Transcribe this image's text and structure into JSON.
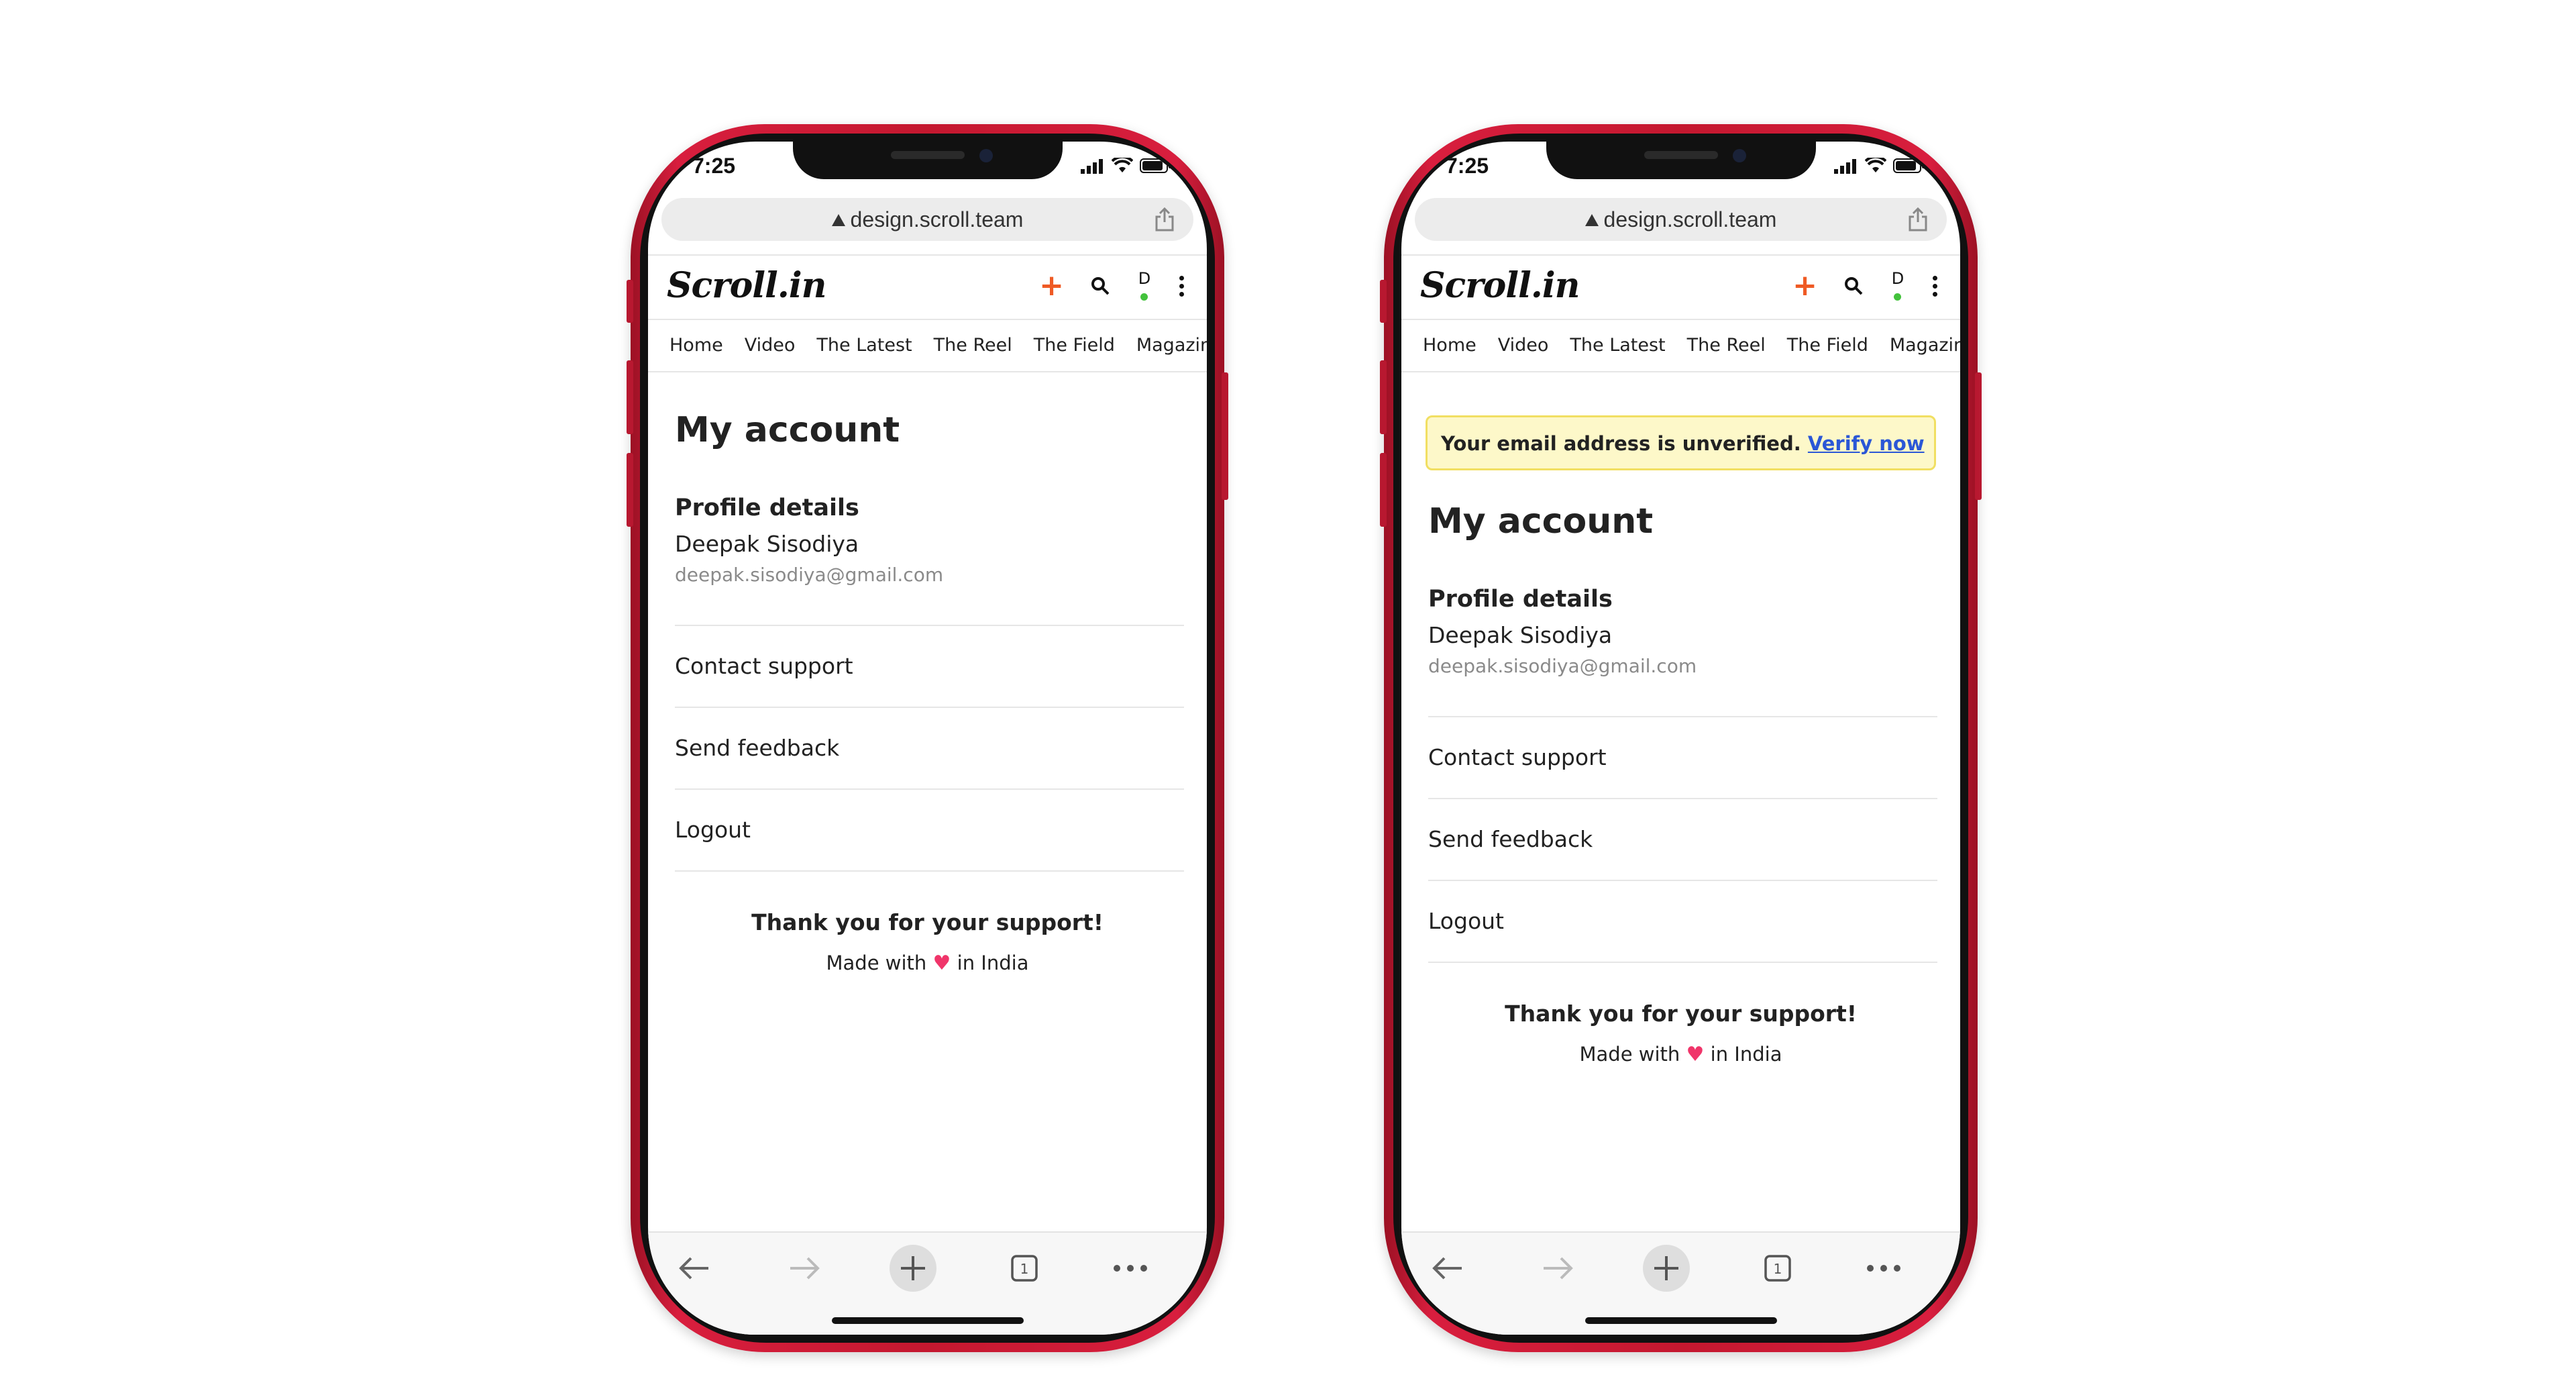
{
  "status_bar": {
    "time": "7:25"
  },
  "browser": {
    "url": "design.scroll.team",
    "tabs_count": "1"
  },
  "site": {
    "logo": "Scroll.in",
    "avatar_letter": "D",
    "nav": [
      "Home",
      "Video",
      "The Latest",
      "The Reel",
      "The Field",
      "Magazine"
    ]
  },
  "account": {
    "title": "My account",
    "profile_heading": "Profile details",
    "name": "Deepak Sisodiya",
    "email": "deepak.sisodiya@gmail.com",
    "menu": [
      "Contact support",
      "Send feedback",
      "Logout"
    ],
    "thanks": "Thank you for your support!",
    "made_with_prefix": "Made with",
    "made_with_suffix": "in India"
  },
  "banner": {
    "text": "Your email address is unverified.",
    "link": "Verify now"
  },
  "colors": {
    "phone_frame": "#c4182f",
    "accent_plus": "#ef5a24",
    "online_dot": "#43c23c",
    "banner_bg": "#fdf8c9",
    "banner_border": "#f1df62",
    "link": "#2b57d6",
    "heart": "#f0356a"
  },
  "icons": {
    "url_lock": "triangle-icon",
    "share": "share-icon",
    "add": "plus-icon",
    "search": "search-icon",
    "more": "kebab-icon",
    "back": "arrow-left-icon",
    "forward": "arrow-right-icon",
    "new_tab": "plus-circle-icon",
    "tabs": "tabs-icon",
    "menu": "ellipsis-icon"
  }
}
